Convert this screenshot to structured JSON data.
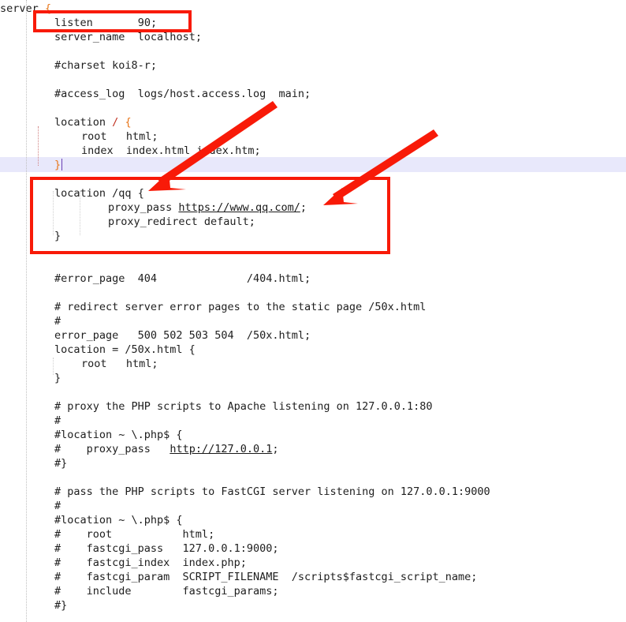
{
  "app": {
    "type": "code-editor",
    "language": "nginx-conf",
    "accent_highlight": "#f81a08",
    "current_line_color": "#e8e8fb",
    "punctuation_color": "#e8761a",
    "text_color": "#202020"
  },
  "code": {
    "lines": [
      "server {",
      "    listen       90;",
      "    server_name  localhost;",
      "",
      "    #charset koi8-r;",
      "",
      "    #access_log  logs/host.access.log  main;",
      "",
      "    location / {",
      "        root   html;",
      "        index  index.html index.htm;",
      "    }",
      "",
      "    location /qq {",
      "            proxy_pass https://www.qq.com/;",
      "            proxy_redirect default;",
      "    }",
      "",
      "",
      "    #error_page  404              /404.html;",
      "",
      "    # redirect server error pages to the static page /50x.html",
      "    #",
      "    error_page   500 502 503 504  /50x.html;",
      "    location = /50x.html {",
      "        root   html;",
      "    }",
      "",
      "    # proxy the PHP scripts to Apache listening on 127.0.0.1:80",
      "    #",
      "    #location ~ \\.php$ {",
      "    #    proxy_pass   http://127.0.0.1;",
      "    #}",
      "",
      "    # pass the PHP scripts to FastCGI server listening on 127.0.0.1:9000",
      "    #",
      "    #location ~ \\.php$ {",
      "    #    root           html;",
      "    #    fastcgi_pass   127.0.0.1:9000;",
      "    #    fastcgi_index  index.php;",
      "    #    fastcgi_param  SCRIPT_FILENAME  /scripts$fastcgi_script_name;",
      "    #    include        fastcgi_params;",
      "    #}"
    ],
    "segments": {
      "l1_text": "server ",
      "l1_brace": "{",
      "l2_key": "listen",
      "l2_value": "90;",
      "l3_key": "server_name",
      "l3_value": "localhost;",
      "l5_comment": "#charset koi8-r;",
      "l7_comment": "#access_log  logs/host.access.log  main;",
      "l9_a": "location ",
      "l9_slash": "/",
      "l9_b": " ",
      "l9_brace": "{",
      "l10": "root   html;",
      "l11": "index  index.html index.htm;",
      "l12_brace": "}",
      "l14_a": "location ",
      "l14_path": "/qq",
      "l14_b": " ",
      "l14_brace": "{",
      "l15_key": "proxy_pass ",
      "l15_url": "https://www.qq.com/",
      "l15_semi": ";",
      "l16": "proxy_redirect default;",
      "l17_brace": "}",
      "l19": "#error_page  404              /404.html;",
      "l21": "# redirect server error pages to the static page /50x.html",
      "l22": "#",
      "l23": "error_page   500 502 503 504  /50x.html;",
      "l24": "location = /50x.html {",
      "l25": "root   html;",
      "l26": "}",
      "l28": "# proxy the PHP scripts to Apache listening on 127.0.0.1:80",
      "l29": "#",
      "l30": "#location ~ \\.php$ {",
      "l31_pre": "#    proxy_pass   ",
      "l31_url": "http://127.0.0.1",
      "l31_semi": ";",
      "l32": "#}",
      "l34": "# pass the PHP scripts to FastCGI server listening on 127.0.0.1:9000",
      "l35": "#",
      "l36": "#location ~ \\.php$ {",
      "l37": "#    root           html;",
      "l38": "#    fastcgi_pass   127.0.0.1:9000;",
      "l39": "#    fastcgi_index  index.php;",
      "l40": "#    fastcgi_param  SCRIPT_FILENAME  /scripts$fastcgi_script_name;",
      "l41": "#    include        fastcgi_params;",
      "l42": "#}"
    }
  },
  "annotations": {
    "color": "#f81a08",
    "boxes": [
      {
        "name": "listen-directive-box",
        "target": "listen       90;"
      },
      {
        "name": "location-qq-block-box",
        "target": "location /qq { ... }"
      }
    ],
    "arrows": [
      {
        "name": "arrow-to-location-qq",
        "points_to": "location /qq {"
      },
      {
        "name": "arrow-to-proxy-pass-url",
        "points_to": "https://www.qq.com/"
      }
    ]
  }
}
